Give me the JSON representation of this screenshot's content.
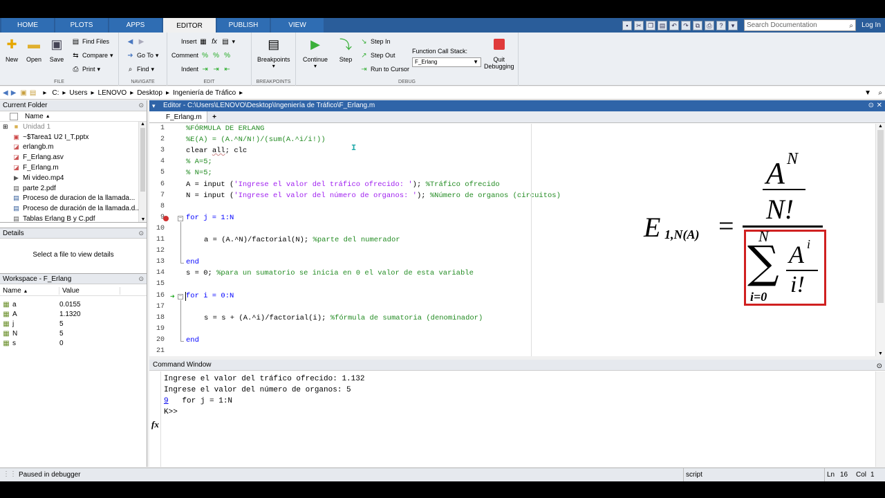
{
  "tabs": [
    "HOME",
    "PLOTS",
    "APPS",
    "EDITOR",
    "PUBLISH",
    "VIEW"
  ],
  "search": {
    "placeholder": "Search Documentation"
  },
  "login": "Log In",
  "ribbon": {
    "file": {
      "label": "FILE",
      "new": "New",
      "open": "Open",
      "save": "Save",
      "find_files": "Find Files",
      "compare": "Compare",
      "print": "Print"
    },
    "navigate": {
      "label": "NAVIGATE",
      "go_to": "Go To",
      "find": "Find"
    },
    "edit": {
      "label": "EDIT",
      "insert": "Insert",
      "comment": "Comment",
      "indent": "Indent"
    },
    "breakpoints": {
      "label": "BREAKPOINTS",
      "btn": "Breakpoints"
    },
    "debug": {
      "label": "DEBUG",
      "continue": "Continue",
      "step": "Step",
      "step_in": "Step In",
      "step_out": "Step Out",
      "run_to_cursor": "Run to Cursor",
      "call_stack_label": "Function Call Stack:",
      "call_stack_value": "F_Erlang",
      "quit": "Quit",
      "debugging": "Debugging"
    }
  },
  "address": [
    "C:",
    "Users",
    "LENOVO",
    "Desktop",
    "Ingeniería de Tráfico"
  ],
  "current_folder": {
    "title": "Current Folder",
    "col_name": "Name",
    "items": [
      {
        "name": "Unidad 1",
        "icon": "folder-icon"
      },
      {
        "name": "~$Tarea1 U2 I_T.pptx",
        "icon": "pptx-icon"
      },
      {
        "name": "erlangb.m",
        "icon": "mfile-icon"
      },
      {
        "name": "F_Erlang.asv",
        "icon": "asv-icon"
      },
      {
        "name": "F_Erlang.m",
        "icon": "mfile-icon"
      },
      {
        "name": "Mi video.mp4",
        "icon": "video-icon"
      },
      {
        "name": "parte 2.pdf",
        "icon": "pdf-icon"
      },
      {
        "name": "Proceso de duracion de la llamada...",
        "icon": "doc-icon"
      },
      {
        "name": "Proceso de duración de la llamada.d...",
        "icon": "doc-icon"
      },
      {
        "name": "Tablas Erlang B y C.pdf",
        "icon": "pdf-icon"
      }
    ]
  },
  "details": {
    "title": "Details",
    "message": "Select a file to view details"
  },
  "workspace": {
    "title": "Workspace - F_Erlang",
    "col_name": "Name",
    "col_value": "Value",
    "vars": [
      {
        "name": "a",
        "value": "0.0155"
      },
      {
        "name": "A",
        "value": "1.1320"
      },
      {
        "name": "j",
        "value": "5"
      },
      {
        "name": "N",
        "value": "5"
      },
      {
        "name": "s",
        "value": "0"
      }
    ]
  },
  "editor": {
    "title": "Editor - C:\\Users\\LENOVO\\Desktop\\Ingeniería de Tráfico\\F_Erlang.m",
    "tab": "F_Erlang.m",
    "plus": "+",
    "lines": [
      {
        "n": "1",
        "code": "%FÓRMULA DE ERLANG",
        "type": "comment"
      },
      {
        "n": "2",
        "code": "%E(A) = (A.^N/N!)/(sum(A.^i/i!))",
        "type": "comment"
      },
      {
        "n": "3",
        "code": "clear all; clc",
        "type": "clear"
      },
      {
        "n": "4",
        "code": "% A=5;",
        "type": "comment"
      },
      {
        "n": "5",
        "code": "% N=5;",
        "type": "comment"
      },
      {
        "n": "6",
        "code": "A = input (",
        "type": "input",
        "str": "'Ingrese el valor del tráfico ofrecido: '",
        "rest": "); ",
        "comment": "%Tráfico ofrecido"
      },
      {
        "n": "7",
        "code": "N = input (",
        "type": "input",
        "str": "'Ingrese el valor del número de organos: '",
        "rest": "); ",
        "comment": "%Número de organos (circuitos)"
      },
      {
        "n": "8",
        "code": "",
        "type": "plain"
      },
      {
        "n": "9",
        "code": "for j = 1:N",
        "type": "for"
      },
      {
        "n": "10",
        "code": "",
        "type": "plain"
      },
      {
        "n": "11",
        "code": "a = (A.^N)/factorial(N); ",
        "type": "codecomment",
        "comment": "%parte del numerador"
      },
      {
        "n": "12",
        "code": "",
        "type": "plain"
      },
      {
        "n": "13",
        "code": "end",
        "type": "end"
      },
      {
        "n": "14",
        "code": "s = 0; ",
        "type": "codecomment",
        "comment": "%para un sumatorio se inicia en 0 el valor de esta variable"
      },
      {
        "n": "15",
        "code": "",
        "type": "plain"
      },
      {
        "n": "16",
        "code": "for i = 0:N",
        "type": "for"
      },
      {
        "n": "17",
        "code": "",
        "type": "plain"
      },
      {
        "n": "18",
        "code": "s = s + (A.^i)/factorial(i); ",
        "type": "codecomment",
        "comment": "%fórmula de sumatoria (denominador)"
      },
      {
        "n": "19",
        "code": "",
        "type": "plain"
      },
      {
        "n": "20",
        "code": "end",
        "type": "end"
      },
      {
        "n": "21",
        "code": "",
        "type": "plain"
      }
    ]
  },
  "formula": {
    "E": "E",
    "sub": "1,N(A)",
    "A": "A",
    "N": "N",
    "Nfact": "N!",
    "sigma": "∑",
    "i": "i",
    "ifact": "i!",
    "lower": "i=0",
    "upper": "N"
  },
  "command_window": {
    "title": "Command Window",
    "line1": "Ingrese el valor del tráfico ofrecido: 1.132",
    "line2": "Ingrese el valor del número de organos: 5",
    "line3_link": "9",
    "line3_code": "   for j = 1:N",
    "prompt": "K>>",
    "fx": "fx"
  },
  "status": {
    "left": "Paused in debugger",
    "mode": "script",
    "ln_label": "Ln",
    "ln": "16",
    "col_label": "Col",
    "col": "1"
  },
  "colors": {
    "ribbon_blue": "#2a5d9a",
    "editor_title": "#2f64a8",
    "comment": "#228b22",
    "string": "#a020f0",
    "keyword": "#0000ff",
    "breakpoint": "#d03030",
    "formula_box": "#d02020"
  }
}
